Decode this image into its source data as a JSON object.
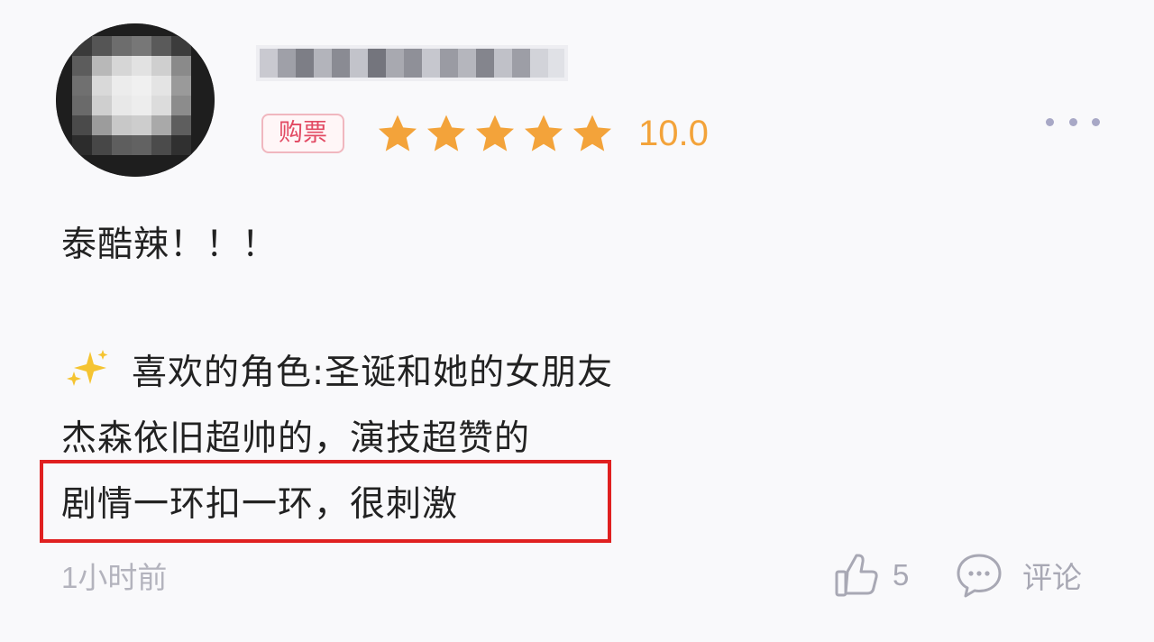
{
  "review": {
    "username": "",
    "ticket_badge": "购票",
    "rating": {
      "stars_filled": 5,
      "stars_total": 5,
      "score": "10.0"
    },
    "lines": [
      "泰酷辣！！！",
      "喜欢的角色:圣诞和她的女朋友",
      "杰森依旧超帅的，演技超赞的",
      "剧情一环扣一环，很刺激"
    ],
    "timestamp": "1小时前",
    "likes": "5",
    "comment_label": "评论"
  },
  "icons": {
    "sparkle": "sparkles-icon",
    "star": "star-icon",
    "like": "thumbs-up-icon",
    "comment": "comment-bubble-icon",
    "more": "more-dots-icon"
  },
  "colors": {
    "star": "#f3a33a",
    "badge_text": "#e24a63",
    "badge_border": "#f0b7bf",
    "highlight": "#e02020",
    "meta_text": "#a8a8b4",
    "more_dots": "#a8a8c6"
  }
}
